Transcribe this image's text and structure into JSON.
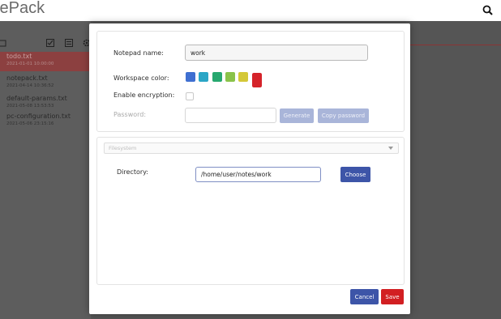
{
  "app": {
    "title": "tePack",
    "search_icon": "search-icon"
  },
  "sidebar": {
    "tool_icons": [
      "folder-icon",
      "checkbox-icon",
      "list-icon",
      "gear-icon"
    ],
    "notes": [
      {
        "name": "todo.txt",
        "date": "2021-01-01 10:00:00",
        "active": true
      },
      {
        "name": "notepack.txt",
        "date": "2021-04-14 10:36:52",
        "active": false
      },
      {
        "name": "default-params.txt",
        "date": "2021-05-08 13:53:53",
        "active": false
      },
      {
        "name": "pc-configuration.txt",
        "date": "2021-05-06 23:15:16",
        "active": false
      }
    ]
  },
  "modal": {
    "notepad_name_label": "Notepad name:",
    "notepad_name_value": "work",
    "workspace_color_label": "Workspace color:",
    "colors": [
      {
        "name": "blue",
        "hex": "#3f6fd1"
      },
      {
        "name": "teal",
        "hex": "#2ba6c6"
      },
      {
        "name": "green",
        "hex": "#27a86f"
      },
      {
        "name": "lime",
        "hex": "#8ac34a"
      },
      {
        "name": "yellow",
        "hex": "#d4c838"
      },
      {
        "name": "red",
        "hex": "#d5232a",
        "selected": true
      }
    ],
    "enable_encryption_label": "Enable encryption:",
    "encryption_enabled": false,
    "password_label": "Password:",
    "password_value": "",
    "generate_label": "Generate",
    "copy_password_label": "Copy password",
    "storage_select": {
      "placeholder": "Filesystem"
    },
    "directory_label": "Directory:",
    "directory_value": "/home/user/notes/work",
    "choose_label": "Choose",
    "cancel_label": "Cancel",
    "save_label": "Save"
  }
}
